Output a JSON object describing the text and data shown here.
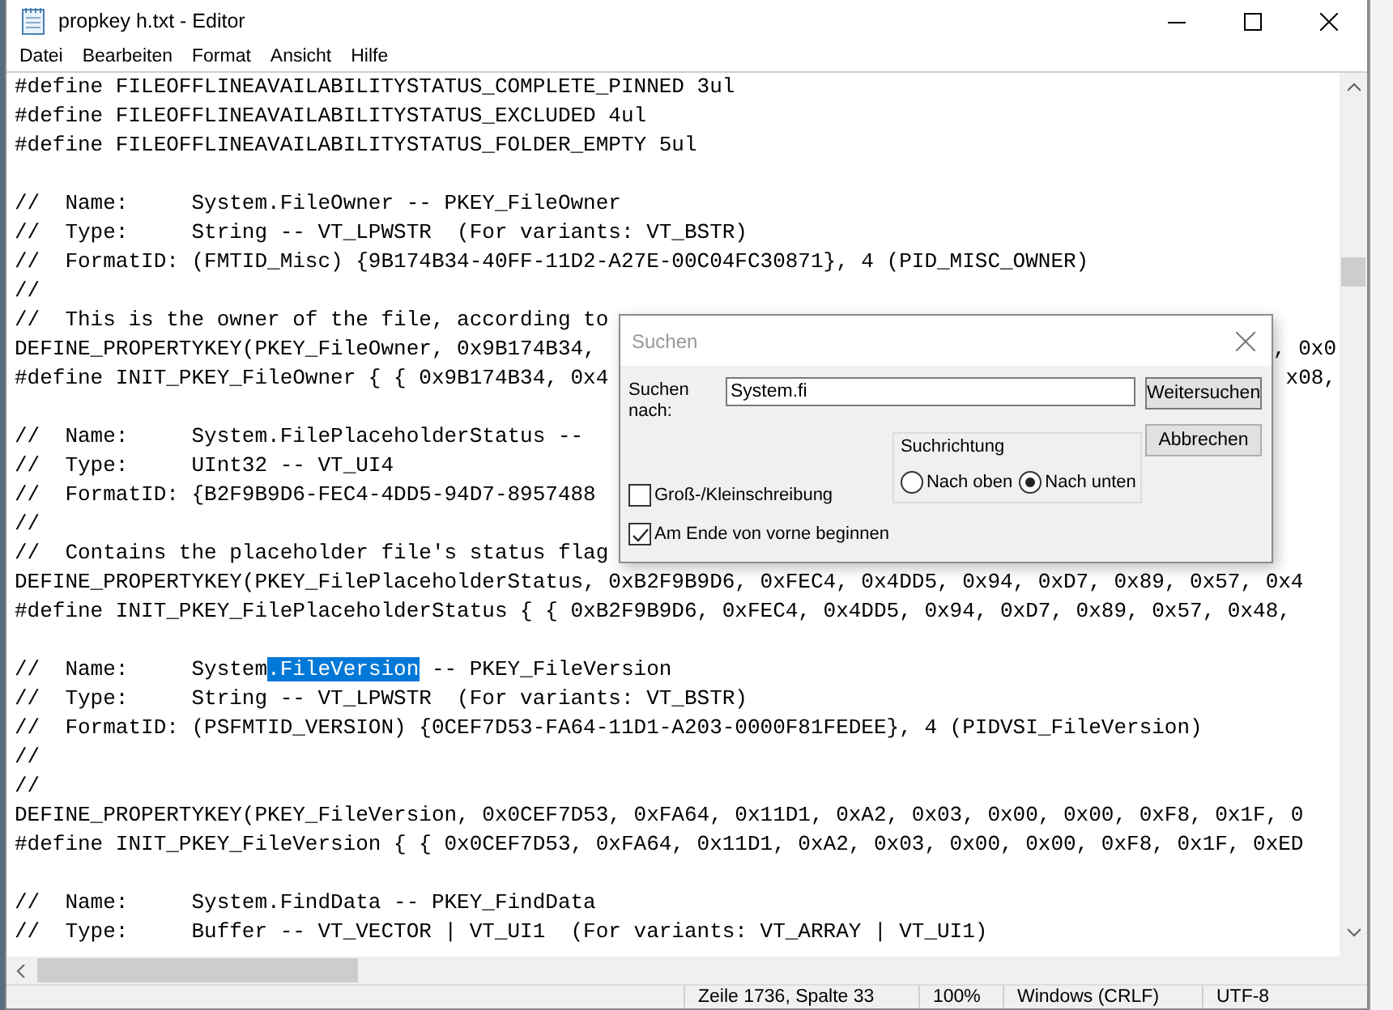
{
  "window": {
    "title": "propkey h.txt - Editor"
  },
  "menu": [
    "Datei",
    "Bearbeiten",
    "Format",
    "Ansicht",
    "Hilfe"
  ],
  "lines": [
    {
      "kind": "code",
      "text": "#define FILEOFFLINEAVAILABILITYSTATUS_COMPLETE_PINNED 3ul"
    },
    {
      "kind": "code",
      "text": "#define FILEOFFLINEAVAILABILITYSTATUS_EXCLUDED 4ul"
    },
    {
      "kind": "code",
      "text": "#define FILEOFFLINEAVAILABILITYSTATUS_FOLDER_EMPTY 5ul"
    },
    {
      "kind": "blank"
    },
    {
      "kind": "code",
      "text": "//  Name:     System.FileOwner -- PKEY_FileOwner"
    },
    {
      "kind": "code",
      "text": "//  Type:     String -- VT_LPWSTR  (For variants: VT_BSTR)"
    },
    {
      "kind": "code",
      "text": "//  FormatID: (FMTID_Misc) {9B174B34-40FF-11D2-A27E-00C04FC30871}, 4 (PID_MISC_OWNER)"
    },
    {
      "kind": "code",
      "text": "//"
    },
    {
      "kind": "code",
      "text": "//  This is the owner of the file, according to"
    },
    {
      "kind": "code",
      "text": "DEFINE_PROPERTYKEY(PKEY_FileOwner, 0x9B174B34,",
      "tail": ", 0x0"
    },
    {
      "kind": "code",
      "text": "#define INIT_PKEY_FileOwner { { 0x9B174B34, 0x4",
      "tail": "x08,"
    },
    {
      "kind": "blank"
    },
    {
      "kind": "code",
      "text": "//  Name:     System.FilePlaceholderStatus --"
    },
    {
      "kind": "code",
      "text": "//  Type:     UInt32 -- VT_UI4"
    },
    {
      "kind": "code",
      "text": "//  FormatID: {B2F9B9D6-FEC4-4DD5-94D7-8957488"
    },
    {
      "kind": "code",
      "text": "//"
    },
    {
      "kind": "code",
      "text": "//  Contains the placeholder file's status flag"
    },
    {
      "kind": "code",
      "text": "DEFINE_PROPERTYKEY(PKEY_FilePlaceholderStatus, 0xB2F9B9D6, 0xFEC4, 0x4DD5, 0x94, 0xD7, 0x89, 0x57, 0x4"
    },
    {
      "kind": "code",
      "text": "#define INIT_PKEY_FilePlaceholderStatus { { 0xB2F9B9D6, 0xFEC4, 0x4DD5, 0x94, 0xD7, 0x89, 0x57, 0x48,"
    },
    {
      "kind": "blank"
    },
    {
      "kind": "selection",
      "before": "//  Name:     System",
      "selected": ".FileVersion",
      "after": " -- PKEY_FileVersion"
    },
    {
      "kind": "code",
      "text": "//  Type:     String -- VT_LPWSTR  (For variants: VT_BSTR)"
    },
    {
      "kind": "code",
      "text": "//  FormatID: (PSFMTID_VERSION) {0CEF7D53-FA64-11D1-A203-0000F81FEDEE}, 4 (PIDVSI_FileVersion)"
    },
    {
      "kind": "code",
      "text": "//"
    },
    {
      "kind": "code",
      "text": "//"
    },
    {
      "kind": "code",
      "text": "DEFINE_PROPERTYKEY(PKEY_FileVersion, 0x0CEF7D53, 0xFA64, 0x11D1, 0xA2, 0x03, 0x00, 0x00, 0xF8, 0x1F, 0"
    },
    {
      "kind": "code",
      "text": "#define INIT_PKEY_FileVersion { { 0x0CEF7D53, 0xFA64, 0x11D1, 0xA2, 0x03, 0x00, 0x00, 0xF8, 0x1F, 0xED"
    },
    {
      "kind": "blank"
    },
    {
      "kind": "code",
      "text": "//  Name:     System.FindData -- PKEY_FindData"
    },
    {
      "kind": "code",
      "text": "//  Type:     Buffer -- VT_VECTOR | VT_UI1  (For variants: VT_ARRAY | VT_UI1)"
    }
  ],
  "status_bar": [
    "Zeile 1736, Spalte 33",
    "100%",
    "Windows (CRLF)",
    "UTF-8"
  ],
  "find_dialog": {
    "title": "Suchen",
    "search_label": "Suchen nach:",
    "search_value": "System.fi",
    "buttons": [
      "Weitersuchen",
      "Abbrechen"
    ],
    "direction": {
      "label": "Suchrichtung",
      "options": [
        {
          "label": "Nach oben",
          "selected": false
        },
        {
          "label": "Nach unten",
          "selected": true
        }
      ]
    },
    "options": [
      {
        "label": "Groß-/Kleinschreibung",
        "checked": false
      },
      {
        "label": "Am Ende von vorne beginnen",
        "checked": true
      }
    ]
  }
}
